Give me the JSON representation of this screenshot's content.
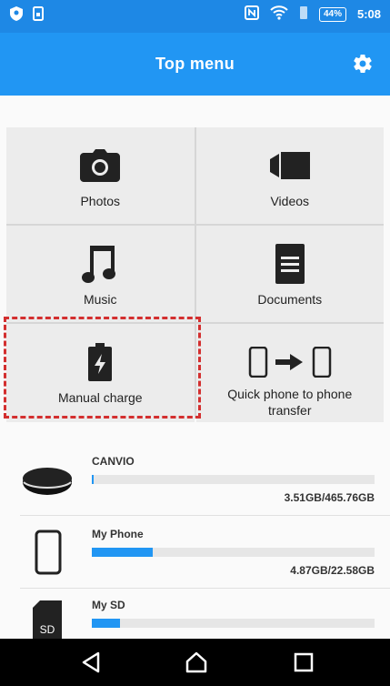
{
  "status_bar": {
    "battery": "44%",
    "time": "5:08"
  },
  "header": {
    "title": "Top menu",
    "settings_icon": "gear-icon"
  },
  "menu": [
    {
      "label": "Photos",
      "icon": "camera-icon"
    },
    {
      "label": "Videos",
      "icon": "video-camera-icon"
    },
    {
      "label": "Music",
      "icon": "music-note-icon"
    },
    {
      "label": "Documents",
      "icon": "document-icon"
    },
    {
      "label": "Manual charge",
      "icon": "battery-charge-icon"
    },
    {
      "label": "Quick phone to phone transfer",
      "icon": "phone-transfer-icon"
    }
  ],
  "storage": [
    {
      "name": "CANVIO",
      "usage": "3.51GB/465.76GB",
      "fraction": 0.0075,
      "icon": "disk-drive-icon"
    },
    {
      "name": "My Phone",
      "usage": "4.87GB/22.58GB",
      "fraction": 0.216,
      "icon": "phone-icon"
    },
    {
      "name": "My SD",
      "usage": "",
      "fraction": 0.1,
      "icon": "sd-card-icon"
    }
  ],
  "colors": {
    "accent": "#2196f3",
    "highlight": "#d32f2f"
  }
}
